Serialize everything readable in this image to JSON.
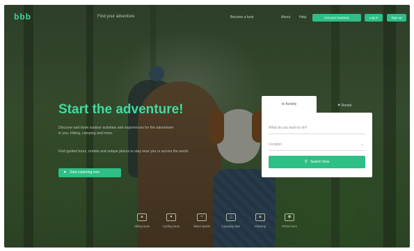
{
  "header": {
    "logo_text": "bbb",
    "tagline": "Find your adventure",
    "nav_links": [
      "Become a host",
      "About",
      "Help"
    ],
    "nav_buttons": [
      "List your business",
      "Log in",
      "Sign up"
    ]
  },
  "hero": {
    "title": "Start the adventure!",
    "description_lines": [
      "Discover and book outdoor activities and experiences for the adventurer",
      "in you. Hiking, camping and more.",
      "Find guided tours, rentals and unique places to stay near you or across the world."
    ],
    "cta_label": "Start exploring now"
  },
  "search": {
    "tabs": [
      "Activity",
      "Rental"
    ],
    "activity_placeholder": "What do you want to do?",
    "location_placeholder": "Location",
    "button_label": "Search Now"
  },
  "categories": [
    {
      "label": "Hiking tours",
      "icon": "boot-icon"
    },
    {
      "label": "Cycling tours",
      "icon": "bike-icon"
    },
    {
      "label": "Water sports",
      "icon": "wave-icon"
    },
    {
      "label": "Camping sites",
      "icon": "tent-icon"
    },
    {
      "label": "Climbing",
      "icon": "mountain-icon"
    },
    {
      "label": "Photo tours",
      "icon": "camera-icon"
    }
  ],
  "colors": {
    "accent": "#2dbf86",
    "accent_text": "#3fdca0"
  }
}
